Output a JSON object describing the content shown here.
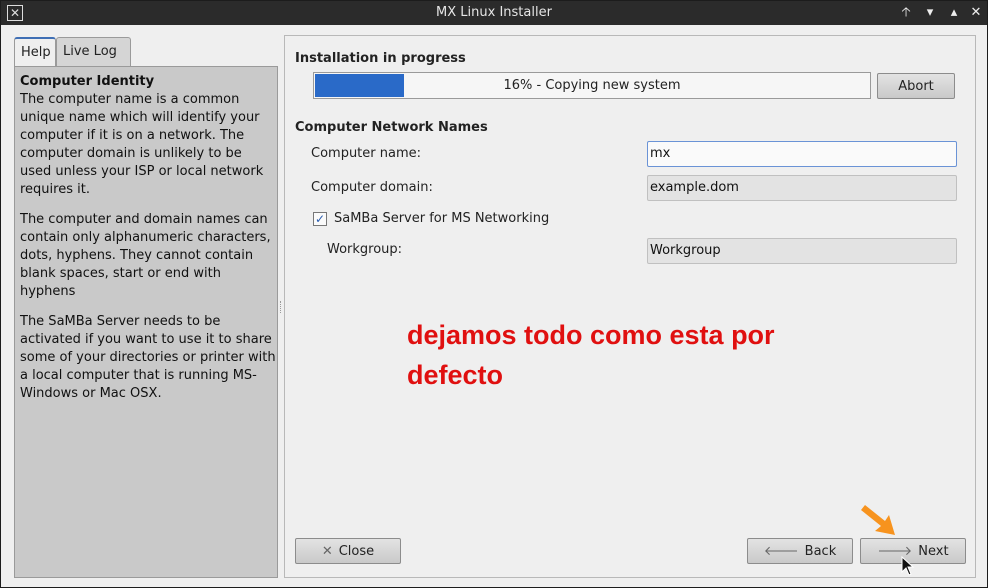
{
  "window": {
    "title": "MX Linux Installer",
    "app_icon": "x-logo-icon",
    "controls": [
      "keep-above-icon",
      "minimize-icon",
      "maximize-icon",
      "close-icon"
    ],
    "ctrl_glyphs": {
      "above": "🡡",
      "min": "▾",
      "max": "▴",
      "close": "✕"
    }
  },
  "tabs": [
    {
      "label": "Help",
      "active": true
    },
    {
      "label": "Live Log",
      "active": false
    }
  ],
  "help": {
    "title": "Computer Identity",
    "paragraphs": [
      "The computer name is a common unique name which will identify your computer if it is on a network. The computer domain is unlikely to be used unless your ISP or local network requires it.",
      "The computer and domain names can contain only alphanumeric characters, dots, hyphens. They cannot contain blank spaces, start or end with hyphens",
      "The SaMBa Server needs to be activated if you want to use it to share some of your directories or printer with a local computer that is running MS-Windows or Mac OSX."
    ]
  },
  "progress": {
    "heading": "Installation in progress",
    "percent": 16,
    "text": "16% - Copying new system",
    "abort_label": "Abort",
    "fill_color": "#2a6ac8"
  },
  "network": {
    "heading": "Computer Network Names",
    "computer_name_label": "Computer name:",
    "computer_name_value": "mx",
    "computer_domain_label": "Computer domain:",
    "computer_domain_value": "example.dom",
    "samba_label": "SaMBa Server for MS Networking",
    "samba_checked": true,
    "samba_check_glyph": "✓",
    "workgroup_label": "Workgroup:",
    "workgroup_value": "Workgroup"
  },
  "annotation": {
    "text": "dejamos todo como esta por defecto",
    "color": "#e01010"
  },
  "buttons": {
    "close": {
      "label": "Close",
      "glyph": "✕"
    },
    "back": {
      "label": "Back",
      "glyph": "🡐"
    },
    "next": {
      "label": "Next",
      "glyph": "🡒"
    }
  }
}
